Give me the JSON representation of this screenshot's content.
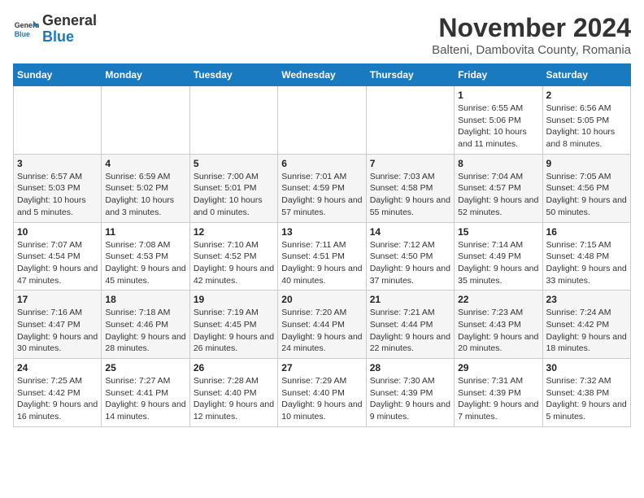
{
  "header": {
    "logo_line1": "General",
    "logo_line2": "Blue",
    "month_year": "November 2024",
    "location": "Balteni, Dambovita County, Romania"
  },
  "weekdays": [
    "Sunday",
    "Monday",
    "Tuesday",
    "Wednesday",
    "Thursday",
    "Friday",
    "Saturday"
  ],
  "weeks": [
    [
      {
        "day": "",
        "info": ""
      },
      {
        "day": "",
        "info": ""
      },
      {
        "day": "",
        "info": ""
      },
      {
        "day": "",
        "info": ""
      },
      {
        "day": "",
        "info": ""
      },
      {
        "day": "1",
        "info": "Sunrise: 6:55 AM\nSunset: 5:06 PM\nDaylight: 10 hours and 11 minutes."
      },
      {
        "day": "2",
        "info": "Sunrise: 6:56 AM\nSunset: 5:05 PM\nDaylight: 10 hours and 8 minutes."
      }
    ],
    [
      {
        "day": "3",
        "info": "Sunrise: 6:57 AM\nSunset: 5:03 PM\nDaylight: 10 hours and 5 minutes."
      },
      {
        "day": "4",
        "info": "Sunrise: 6:59 AM\nSunset: 5:02 PM\nDaylight: 10 hours and 3 minutes."
      },
      {
        "day": "5",
        "info": "Sunrise: 7:00 AM\nSunset: 5:01 PM\nDaylight: 10 hours and 0 minutes."
      },
      {
        "day": "6",
        "info": "Sunrise: 7:01 AM\nSunset: 4:59 PM\nDaylight: 9 hours and 57 minutes."
      },
      {
        "day": "7",
        "info": "Sunrise: 7:03 AM\nSunset: 4:58 PM\nDaylight: 9 hours and 55 minutes."
      },
      {
        "day": "8",
        "info": "Sunrise: 7:04 AM\nSunset: 4:57 PM\nDaylight: 9 hours and 52 minutes."
      },
      {
        "day": "9",
        "info": "Sunrise: 7:05 AM\nSunset: 4:56 PM\nDaylight: 9 hours and 50 minutes."
      }
    ],
    [
      {
        "day": "10",
        "info": "Sunrise: 7:07 AM\nSunset: 4:54 PM\nDaylight: 9 hours and 47 minutes."
      },
      {
        "day": "11",
        "info": "Sunrise: 7:08 AM\nSunset: 4:53 PM\nDaylight: 9 hours and 45 minutes."
      },
      {
        "day": "12",
        "info": "Sunrise: 7:10 AM\nSunset: 4:52 PM\nDaylight: 9 hours and 42 minutes."
      },
      {
        "day": "13",
        "info": "Sunrise: 7:11 AM\nSunset: 4:51 PM\nDaylight: 9 hours and 40 minutes."
      },
      {
        "day": "14",
        "info": "Sunrise: 7:12 AM\nSunset: 4:50 PM\nDaylight: 9 hours and 37 minutes."
      },
      {
        "day": "15",
        "info": "Sunrise: 7:14 AM\nSunset: 4:49 PM\nDaylight: 9 hours and 35 minutes."
      },
      {
        "day": "16",
        "info": "Sunrise: 7:15 AM\nSunset: 4:48 PM\nDaylight: 9 hours and 33 minutes."
      }
    ],
    [
      {
        "day": "17",
        "info": "Sunrise: 7:16 AM\nSunset: 4:47 PM\nDaylight: 9 hours and 30 minutes."
      },
      {
        "day": "18",
        "info": "Sunrise: 7:18 AM\nSunset: 4:46 PM\nDaylight: 9 hours and 28 minutes."
      },
      {
        "day": "19",
        "info": "Sunrise: 7:19 AM\nSunset: 4:45 PM\nDaylight: 9 hours and 26 minutes."
      },
      {
        "day": "20",
        "info": "Sunrise: 7:20 AM\nSunset: 4:44 PM\nDaylight: 9 hours and 24 minutes."
      },
      {
        "day": "21",
        "info": "Sunrise: 7:21 AM\nSunset: 4:44 PM\nDaylight: 9 hours and 22 minutes."
      },
      {
        "day": "22",
        "info": "Sunrise: 7:23 AM\nSunset: 4:43 PM\nDaylight: 9 hours and 20 minutes."
      },
      {
        "day": "23",
        "info": "Sunrise: 7:24 AM\nSunset: 4:42 PM\nDaylight: 9 hours and 18 minutes."
      }
    ],
    [
      {
        "day": "24",
        "info": "Sunrise: 7:25 AM\nSunset: 4:42 PM\nDaylight: 9 hours and 16 minutes."
      },
      {
        "day": "25",
        "info": "Sunrise: 7:27 AM\nSunset: 4:41 PM\nDaylight: 9 hours and 14 minutes."
      },
      {
        "day": "26",
        "info": "Sunrise: 7:28 AM\nSunset: 4:40 PM\nDaylight: 9 hours and 12 minutes."
      },
      {
        "day": "27",
        "info": "Sunrise: 7:29 AM\nSunset: 4:40 PM\nDaylight: 9 hours and 10 minutes."
      },
      {
        "day": "28",
        "info": "Sunrise: 7:30 AM\nSunset: 4:39 PM\nDaylight: 9 hours and 9 minutes."
      },
      {
        "day": "29",
        "info": "Sunrise: 7:31 AM\nSunset: 4:39 PM\nDaylight: 9 hours and 7 minutes."
      },
      {
        "day": "30",
        "info": "Sunrise: 7:32 AM\nSunset: 4:38 PM\nDaylight: 9 hours and 5 minutes."
      }
    ]
  ]
}
